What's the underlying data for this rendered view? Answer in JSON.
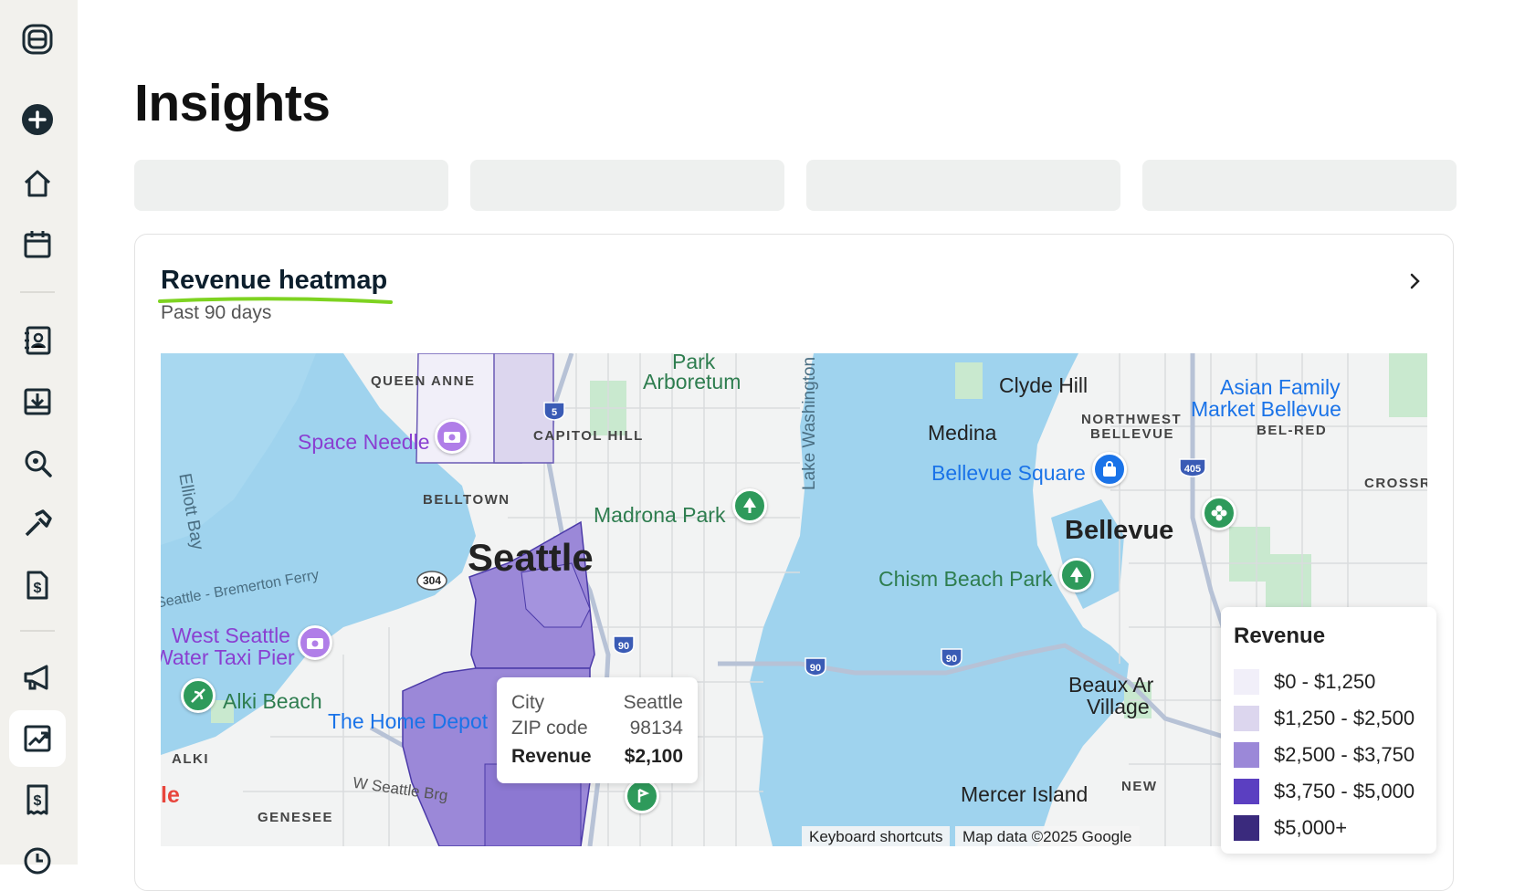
{
  "page": {
    "title": "Insights"
  },
  "sidebar": {
    "items": [
      {
        "icon": "logo-icon"
      },
      {
        "icon": "plus-circle-icon"
      },
      {
        "icon": "home-icon"
      },
      {
        "icon": "calendar-icon"
      },
      {
        "icon": "contacts-icon"
      },
      {
        "icon": "inbox-download-icon"
      },
      {
        "icon": "search-settings-icon"
      },
      {
        "icon": "hammer-icon"
      },
      {
        "icon": "invoice-dollar-icon"
      },
      {
        "icon": "megaphone-icon"
      },
      {
        "icon": "chart-icon",
        "active": true
      },
      {
        "icon": "receipt-dollar-icon"
      },
      {
        "icon": "clock-icon"
      }
    ]
  },
  "card": {
    "title": "Revenue heatmap",
    "subtitle": "Past 90 days",
    "underline_color": "#7ed321"
  },
  "map": {
    "labels": {
      "queen_anne": "QUEEN ANNE",
      "capitol_hill": "CAPITOL HILL",
      "belltown": "BELLTOWN",
      "seattle": "Seattle",
      "park": "Park",
      "arboretum": "Arboretum",
      "madrona_park": "Madrona Park",
      "lake_washington": "Lake Washington",
      "space_needle": "Space Needle",
      "elliott_bay": "Elliott Bay",
      "ferry": "Seattle - Bremerton Ferry",
      "west_seattle": "West Seattle",
      "water_taxi": "Water Taxi Pier",
      "alki_beach": "Alki Beach",
      "alki": "ALKI",
      "home_depot": "The Home Depot",
      "w_seattle_brg": "W Seattle Brg",
      "clyde_hill": "Clyde Hill",
      "medina": "Medina",
      "northwest_bellevue_1": "NORTHWEST",
      "northwest_bellevue_2": "BELLEVUE",
      "bel_red": "BEL-RED",
      "asian_family_1": "Asian Family",
      "asian_family_2": "Market Bellevue",
      "bellevue_square": "Bellevue Square",
      "crossroads": "CROSSRO",
      "bellevue": "Bellevue",
      "chism_beach": "Chism Beach Park",
      "beaux_arts_1": "Beaux Ar",
      "beaux_arts_2": "Village",
      "mercer_island": "Mercer Island",
      "new": "NEW",
      "genesee": "GENESEE",
      "google": "le"
    },
    "shields": [
      "5",
      "304",
      "90",
      "90",
      "90",
      "405"
    ],
    "attribution": {
      "keyboard": "Keyboard shortcuts",
      "map_data": "Map data ©2025 Google"
    },
    "tooltip": {
      "city_label": "City",
      "city_value": "Seattle",
      "zip_label": "ZIP code",
      "zip_value": "98134",
      "revenue_label": "Revenue",
      "revenue_value": "$2,100"
    },
    "legend": {
      "title": "Revenue",
      "ranges": [
        {
          "label": "$0 - $1,250",
          "color": "#f1eff9"
        },
        {
          "label": "$1,250 - $2,500",
          "color": "#dcd6ee"
        },
        {
          "label": "$2,500 - $3,750",
          "color": "#9b88d8"
        },
        {
          "label": "$3,750 - $5,000",
          "color": "#5b3fc1"
        },
        {
          "label": "$5,000+",
          "color": "#3a2a7d"
        }
      ]
    }
  }
}
